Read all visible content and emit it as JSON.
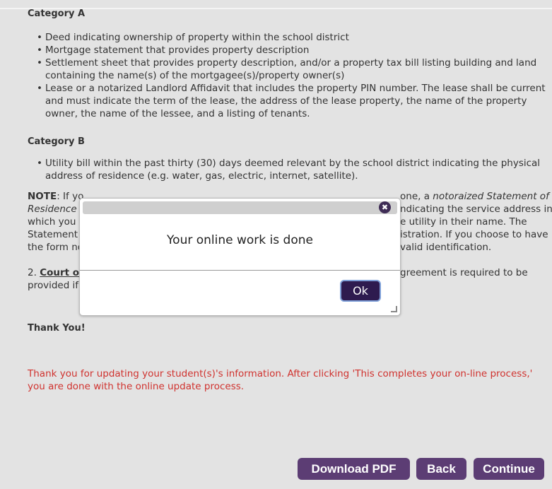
{
  "category_a": {
    "heading": "Category A",
    "items": [
      "Deed indicating ownership of property within the school district",
      "Mortgage statement that provides property description",
      "Settlement sheet that provides property description, and/or a property tax bill listing building and land containing the name(s) of the mortgagee(s)/property owner(s)",
      "Lease or a notarized Landlord Affidavit that includes the property PIN number. The lease shall be current and must indicate the term of the lease, the address of the lease property, the name of the property owner, the name of the lessee, and a listing of tenants."
    ]
  },
  "category_b": {
    "heading": "Category B",
    "items": [
      "Utility bill within the past thirty (30) days deemed relevant by the school district indicating the physical address of residence (e.g. water, gas, electric, internet, satellite)."
    ]
  },
  "note": {
    "label": "NOTE",
    "line1_start": ": If yo",
    "line1_end": "one, a",
    "line1_italic": "notoraized Statement of",
    "line2_italic": "Residence",
    "line2_end": "ndicating the service address in",
    "line3_start": "which you",
    "line3_end": "e utility in their name. The",
    "line4_start": "Statement",
    "line4_end": "istration. If you choose to have",
    "line5_start": "the form no",
    "line5_end": "valid identification."
  },
  "court": {
    "num": "2.",
    "link": "Court or",
    "line1_end": "greement is required to be",
    "line2_start": "provided if"
  },
  "thank_you": "Thank You!",
  "completion_message": "Thank you for updating your student(s)'s information. After clicking 'This completes your on-line process,' you are done with the online update process.",
  "buttons": {
    "download": "Download PDF",
    "back": "Back",
    "continue": "Continue"
  },
  "dialog": {
    "message": "Your online work is done",
    "ok": "Ok",
    "close_glyph": "✖"
  }
}
